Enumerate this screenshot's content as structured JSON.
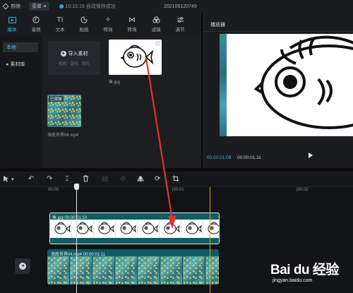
{
  "titlebar": {
    "app_name": "剪映",
    "menu_label": "菜单",
    "status_text": "10:15:19 自动保存成功",
    "project_name": "202105120749"
  },
  "toolbar": {
    "tools": [
      {
        "label": "媒体",
        "icon": "media-icon",
        "glyph": "▣"
      },
      {
        "label": "音频",
        "icon": "audio-icon",
        "glyph": "◔"
      },
      {
        "label": "文本",
        "icon": "text-icon",
        "glyph": "TI"
      },
      {
        "label": "贴纸",
        "icon": "sticker-icon",
        "glyph": "◕"
      },
      {
        "label": "特效",
        "icon": "effects-icon",
        "glyph": "✧"
      },
      {
        "label": "转场",
        "icon": "transition-icon",
        "glyph": "⋈"
      },
      {
        "label": "滤镜",
        "icon": "filter-icon",
        "glyph": "❀"
      },
      {
        "label": "调节",
        "icon": "adjust-icon",
        "glyph": "⚟"
      }
    ]
  },
  "sidenav": {
    "local": "本地",
    "library": "▸ 素材库"
  },
  "media": {
    "import_label": "导入素材",
    "import_sub": "视频、音频、图片",
    "fish_name": "鱼.jpg",
    "ocean_added": "已添加",
    "ocean_name": "海底世界04.mp4"
  },
  "player": {
    "title": "播放器",
    "current_time": "00:00:01:09",
    "total_time": "00:00:01:11"
  },
  "timeline": {
    "ruler_ticks": [
      "00:00",
      "|00:01",
      "|00:02"
    ],
    "fish_clip": "鱼.jpg   00:00:01:10",
    "ocean_clip": "海底世界04.mp4   00:00:01:11"
  },
  "watermark": {
    "brand": "Bai du 经验",
    "url": "jingyan.baidu.com"
  },
  "colors": {
    "accent": "#22c3d8",
    "clip_bg": "#0f5d63",
    "arrow": "#e5322d",
    "end_marker": "#d8a318"
  }
}
